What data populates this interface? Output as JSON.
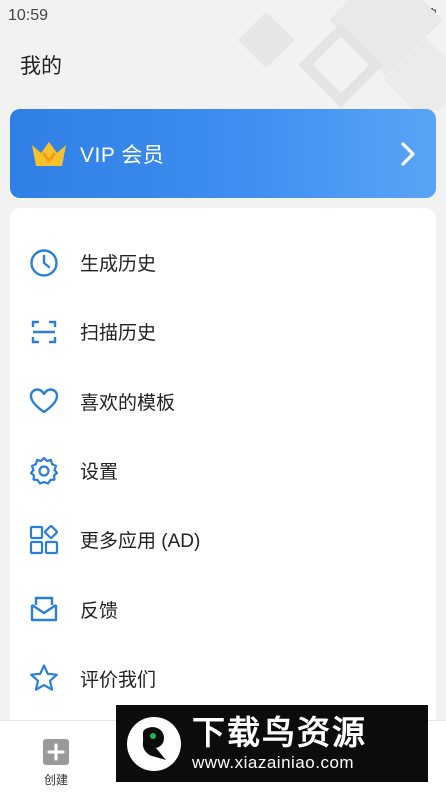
{
  "status_bar": {
    "time": "10:59",
    "icons": [
      "vibrate-icon",
      "wifi-icon",
      "signal-icon",
      "battery-icon"
    ]
  },
  "header": {
    "title": "我的"
  },
  "vip": {
    "label": "VIP 会员",
    "icon": "crown-icon"
  },
  "menu": {
    "items": [
      {
        "label": "生成历史",
        "icon": "clock-icon"
      },
      {
        "label": "扫描历史",
        "icon": "scan-icon"
      },
      {
        "label": "喜欢的模板",
        "icon": "heart-icon"
      },
      {
        "label": "设置",
        "icon": "gear-icon"
      },
      {
        "label": "更多应用 (AD)",
        "icon": "apps-icon"
      },
      {
        "label": "反馈",
        "icon": "mail-icon"
      },
      {
        "label": "评价我们",
        "icon": "star-icon"
      }
    ]
  },
  "bottom_nav": {
    "create_label": "创建"
  },
  "watermark": {
    "title": "下载鸟资源",
    "url": "www.xiazainiao.com"
  },
  "colors": {
    "accent": "#2f7fe6",
    "icon_blue": "#2a7fd8",
    "crown": "#f6c22c"
  }
}
